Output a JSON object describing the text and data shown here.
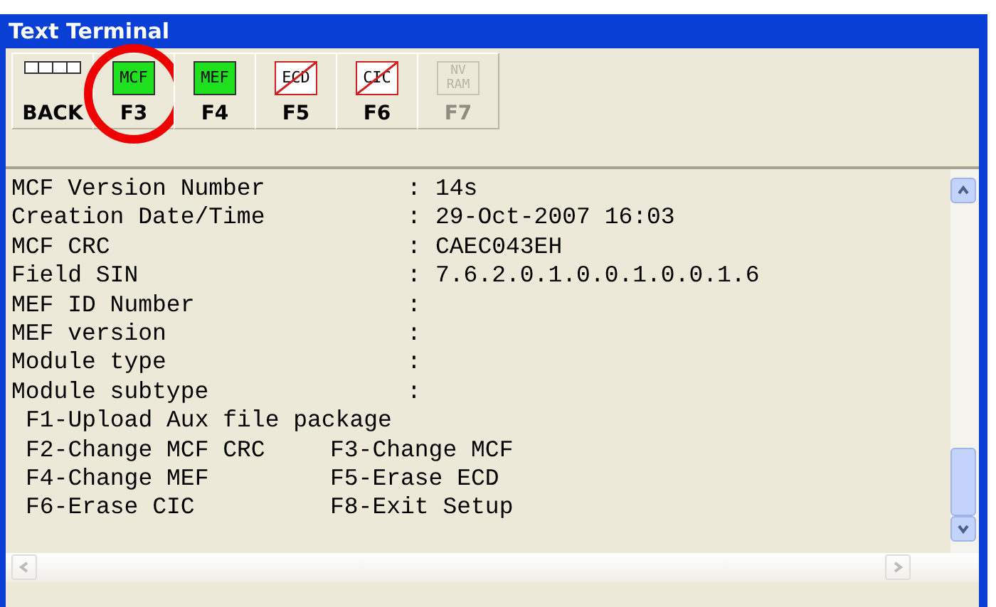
{
  "window": {
    "title": "Text Terminal"
  },
  "toolbar": [
    {
      "key": "BACK",
      "kind": "back",
      "disabled": false,
      "circled": false
    },
    {
      "key": "F3",
      "kind": "loaded",
      "icon_lines": [
        "MCF"
      ],
      "disabled": false,
      "circled": true
    },
    {
      "key": "F4",
      "kind": "loaded",
      "icon_lines": [
        "MEF"
      ],
      "disabled": false,
      "circled": false
    },
    {
      "key": "F5",
      "kind": "erased",
      "icon_lines": [
        "ECD"
      ],
      "disabled": false,
      "circled": false
    },
    {
      "key": "F6",
      "kind": "erased",
      "icon_lines": [
        "CIC"
      ],
      "disabled": false,
      "circled": false
    },
    {
      "key": "F7",
      "kind": "blank",
      "icon_lines": [
        "NV",
        "RAM"
      ],
      "disabled": true,
      "circled": false
    }
  ],
  "terminal": {
    "fields": [
      {
        "label": "MCF Version Number",
        "separator": ":",
        "value": "14s"
      },
      {
        "label": "Creation Date/Time",
        "separator": ":",
        "value": "29-Oct-2007 16:03"
      },
      {
        "label": "MCF CRC",
        "separator": ":",
        "value": "CAEC043EH"
      },
      {
        "label": "Field SIN",
        "separator": ":",
        "value": "7.6.2.0.1.0.0.1.0.0.1.6"
      },
      {
        "label": "MEF ID Number",
        "separator": ":"
      },
      {
        "label": "MEF version",
        "separator": ":"
      },
      {
        "label": "Module type",
        "separator": ":"
      },
      {
        "label": "Module subtype",
        "separator": ":"
      }
    ],
    "menu": [
      [
        "F1-Upload Aux file package"
      ],
      [
        "F2-Change MCF CRC",
        "F3-Change MCF"
      ],
      [
        "F4-Change MEF",
        "F5-Erase ECD"
      ],
      [
        "F6-Erase CIC",
        "F8-Exit Setup"
      ]
    ]
  }
}
